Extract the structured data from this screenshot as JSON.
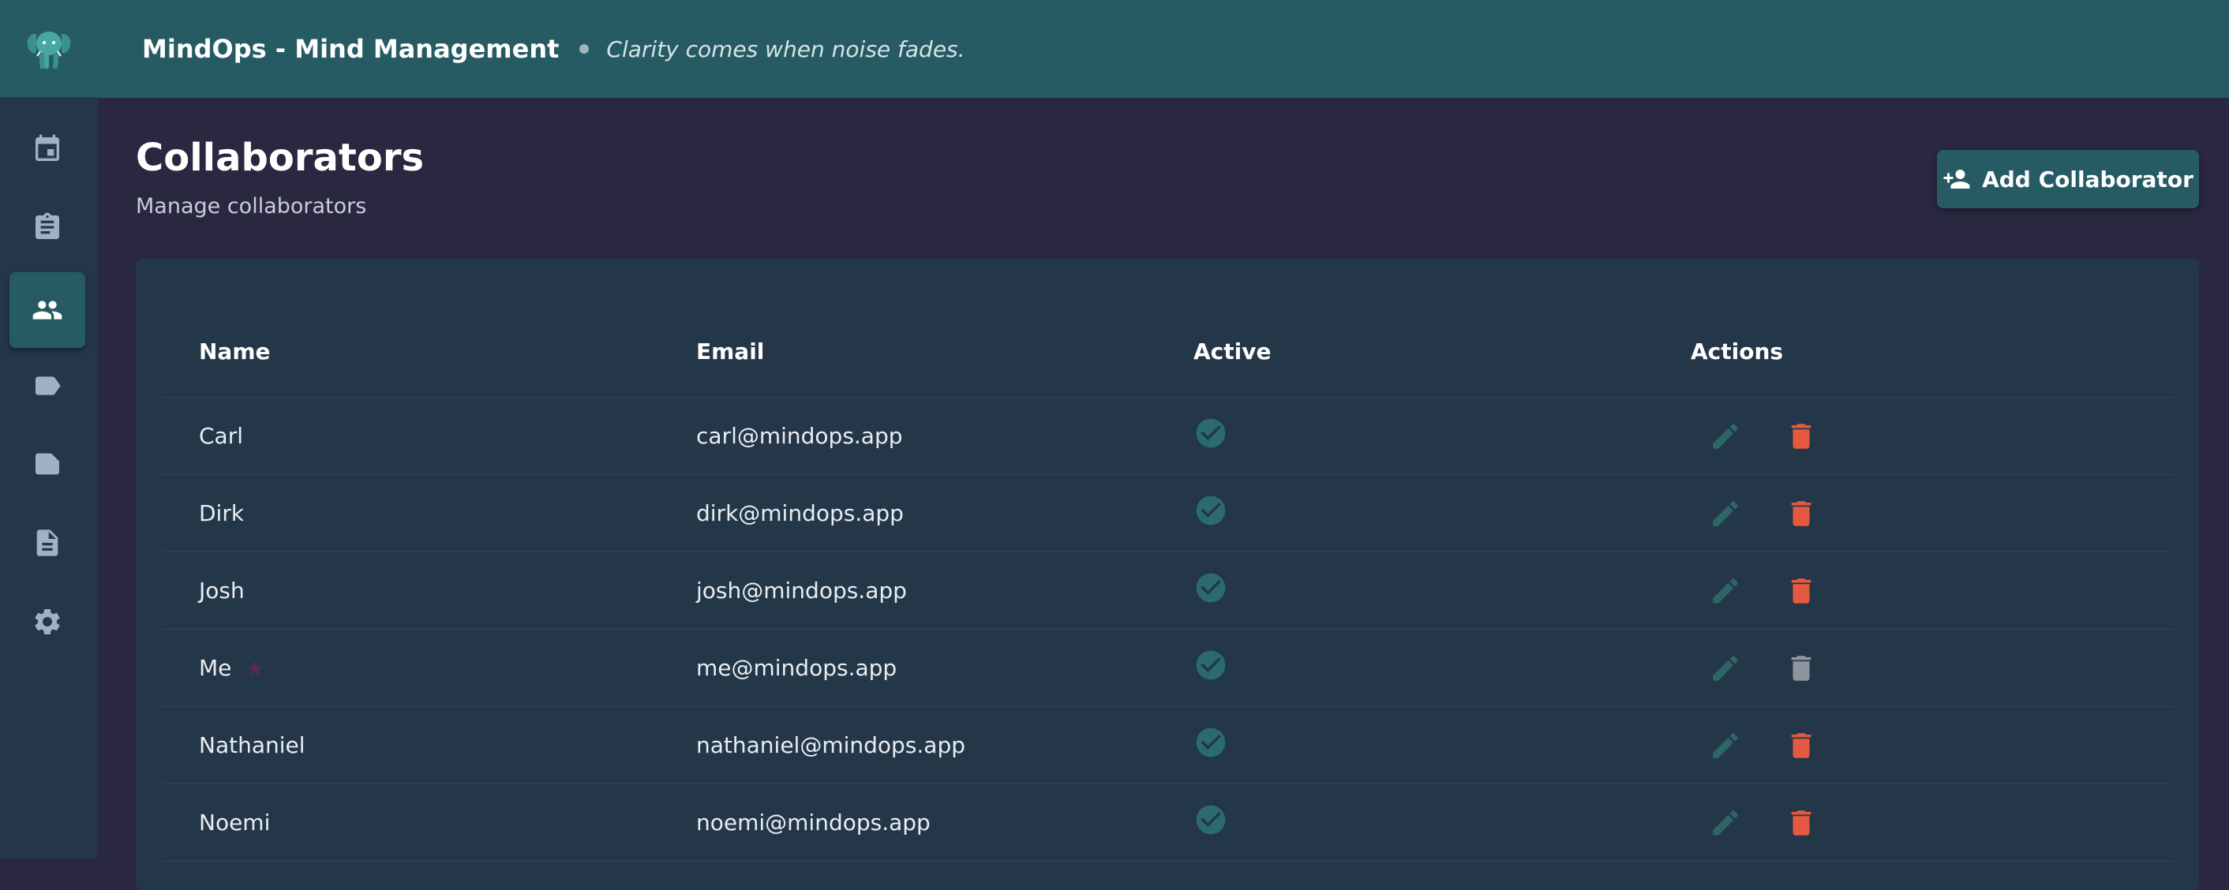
{
  "header": {
    "app_title": "MindOps - Mind Management",
    "tagline": "Clarity comes when noise fades."
  },
  "sidebar": {
    "items": [
      {
        "icon": "calendar-icon",
        "active": false
      },
      {
        "icon": "clipboard-icon",
        "active": false
      },
      {
        "icon": "people-icon",
        "active": true
      },
      {
        "icon": "label-icon",
        "active": false
      },
      {
        "icon": "folder-label-icon",
        "active": false
      },
      {
        "icon": "document-icon",
        "active": false
      },
      {
        "icon": "gear-icon",
        "active": false
      }
    ]
  },
  "page": {
    "title": "Collaborators",
    "subtitle": "Manage collaborators",
    "add_button_label": "Add Collaborator"
  },
  "table": {
    "columns": [
      "Name",
      "Email",
      "Active",
      "Actions"
    ],
    "rows": [
      {
        "name": "Carl",
        "email": "carl@mindops.app",
        "active": true,
        "is_me": false,
        "deletable": true
      },
      {
        "name": "Dirk",
        "email": "dirk@mindops.app",
        "active": true,
        "is_me": false,
        "deletable": true
      },
      {
        "name": "Josh",
        "email": "josh@mindops.app",
        "active": true,
        "is_me": false,
        "deletable": true
      },
      {
        "name": "Me",
        "email": "me@mindops.app",
        "active": true,
        "is_me": true,
        "deletable": false
      },
      {
        "name": "Nathaniel",
        "email": "nathaniel@mindops.app",
        "active": true,
        "is_me": false,
        "deletable": true
      },
      {
        "name": "Noemi",
        "email": "noemi@mindops.app",
        "active": true,
        "is_me": false,
        "deletable": true
      }
    ]
  },
  "colors": {
    "accent": "#265b63",
    "check": "#2b6b6c",
    "edit": "#2e6665",
    "delete": "#e4593f",
    "delete_disabled": "#8f959c",
    "star": "#5a2a55"
  }
}
